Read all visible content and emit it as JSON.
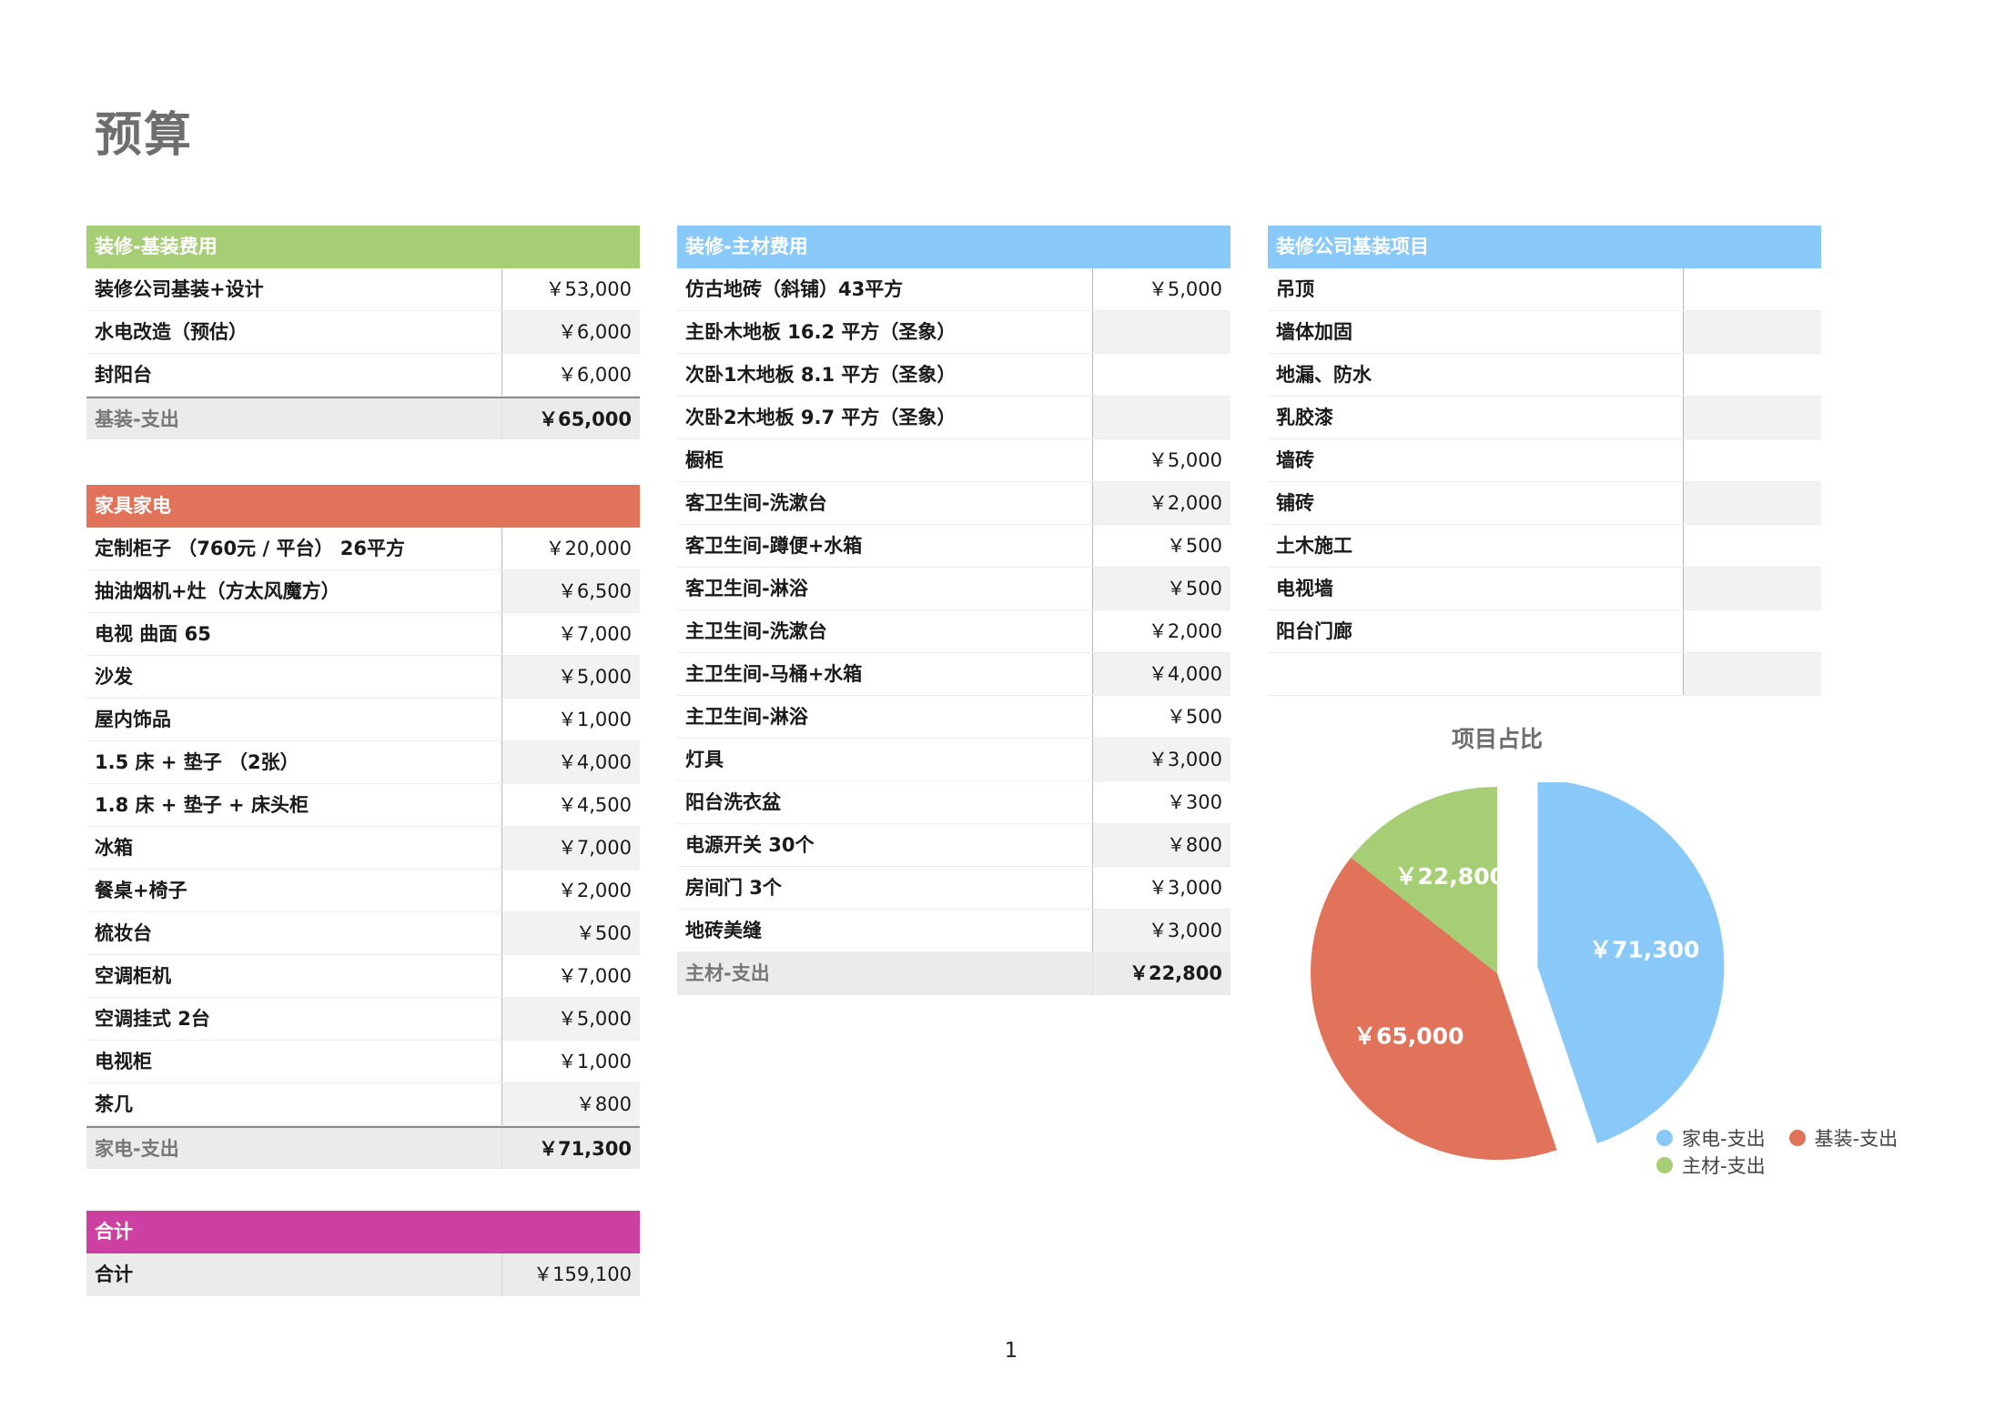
{
  "page": {
    "title": "预算",
    "page_number": "1"
  },
  "colors": {
    "base": "#a6ce74",
    "material": "#88c9f9",
    "company": "#88c9f9",
    "furniture": "#e1735a",
    "total": "#cb40a1"
  },
  "base_table": {
    "header": "装修-基装费用",
    "rows": [
      {
        "label": "装修公司基装+设计",
        "value": "￥53,000"
      },
      {
        "label": "水电改造（预估）",
        "value": "￥6,000"
      },
      {
        "label": "封阳台",
        "value": "￥6,000"
      }
    ],
    "total": {
      "label": "基装-支出",
      "value": "￥65,000"
    }
  },
  "furniture_table": {
    "header": "家具家电",
    "rows": [
      {
        "label": "定制柜子 （760元 / 平台） 26平方",
        "value": "￥20,000"
      },
      {
        "label": "抽油烟机+灶（方太风魔方）",
        "value": "￥6,500"
      },
      {
        "label": "电视 曲面 65",
        "value": "￥7,000"
      },
      {
        "label": "沙发",
        "value": "￥5,000"
      },
      {
        "label": "屋内饰品",
        "value": "￥1,000"
      },
      {
        "label": "1.5 床 + 垫子 （2张）",
        "value": "￥4,000"
      },
      {
        "label": "1.8 床 + 垫子 + 床头柜",
        "value": "￥4,500"
      },
      {
        "label": "冰箱",
        "value": "￥7,000"
      },
      {
        "label": "餐桌+椅子",
        "value": "￥2,000"
      },
      {
        "label": "梳妆台",
        "value": "￥500"
      },
      {
        "label": "空调柜机",
        "value": "￥7,000"
      },
      {
        "label": "空调挂式 2台",
        "value": "￥5,000"
      },
      {
        "label": "电视柜",
        "value": "￥1,000"
      },
      {
        "label": "茶几",
        "value": "￥800"
      }
    ],
    "total": {
      "label": "家电-支出",
      "value": "￥71,300"
    }
  },
  "sum_table": {
    "header": "合计",
    "row": {
      "label": "合计",
      "value": "￥159,100"
    }
  },
  "material_table": {
    "header": "装修-主材费用",
    "rows": [
      {
        "label": "仿古地砖（斜铺）43平方",
        "value": "￥5,000"
      },
      {
        "label": "主卧木地板 16.2 平方（圣象）",
        "value": ""
      },
      {
        "label": "次卧1木地板 8.1 平方（圣象）",
        "value": ""
      },
      {
        "label": "次卧2木地板 9.7 平方（圣象）",
        "value": ""
      },
      {
        "label": "橱柜",
        "value": "￥5,000"
      },
      {
        "label": "客卫生间-洗漱台",
        "value": "￥2,000"
      },
      {
        "label": "客卫生间-蹲便+水箱",
        "value": "￥500"
      },
      {
        "label": "客卫生间-淋浴",
        "value": "￥500"
      },
      {
        "label": "主卫生间-洗漱台",
        "value": "￥2,000"
      },
      {
        "label": "主卫生间-马桶+水箱",
        "value": "￥4,000"
      },
      {
        "label": "主卫生间-淋浴",
        "value": "￥500"
      },
      {
        "label": "灯具",
        "value": "￥3,000"
      },
      {
        "label": "阳台洗衣盆",
        "value": "￥300"
      },
      {
        "label": "电源开关 30个",
        "value": "￥800"
      },
      {
        "label": "房间门 3个",
        "value": "￥3,000"
      },
      {
        "label": "地砖美缝",
        "value": "￥3,000"
      }
    ],
    "total": {
      "label": "主材-支出",
      "value": "￥22,800"
    }
  },
  "company_table": {
    "header": "装修公司基装项目",
    "rows": [
      {
        "label": "吊顶",
        "value": ""
      },
      {
        "label": "墙体加固",
        "value": ""
      },
      {
        "label": "地漏、防水",
        "value": ""
      },
      {
        "label": "乳胶漆",
        "value": ""
      },
      {
        "label": "墙砖",
        "value": ""
      },
      {
        "label": "铺砖",
        "value": ""
      },
      {
        "label": "土木施工",
        "value": ""
      },
      {
        "label": "电视墙",
        "value": ""
      },
      {
        "label": "阳台门廊",
        "value": ""
      },
      {
        "label": "",
        "value": ""
      }
    ]
  },
  "chart_data": {
    "type": "pie",
    "title": "项目占比",
    "series": [
      {
        "name": "家电-支出",
        "value": 71300,
        "label": "￥71,300",
        "color": "#88c9f9",
        "exploded": true
      },
      {
        "name": "基装-支出",
        "value": 65000,
        "label": "￥65,000",
        "color": "#e1735a",
        "exploded": false
      },
      {
        "name": "主材-支出",
        "value": 22800,
        "label": "￥22,800",
        "color": "#a6ce74",
        "exploded": false
      }
    ],
    "legend": "bottom-right"
  }
}
